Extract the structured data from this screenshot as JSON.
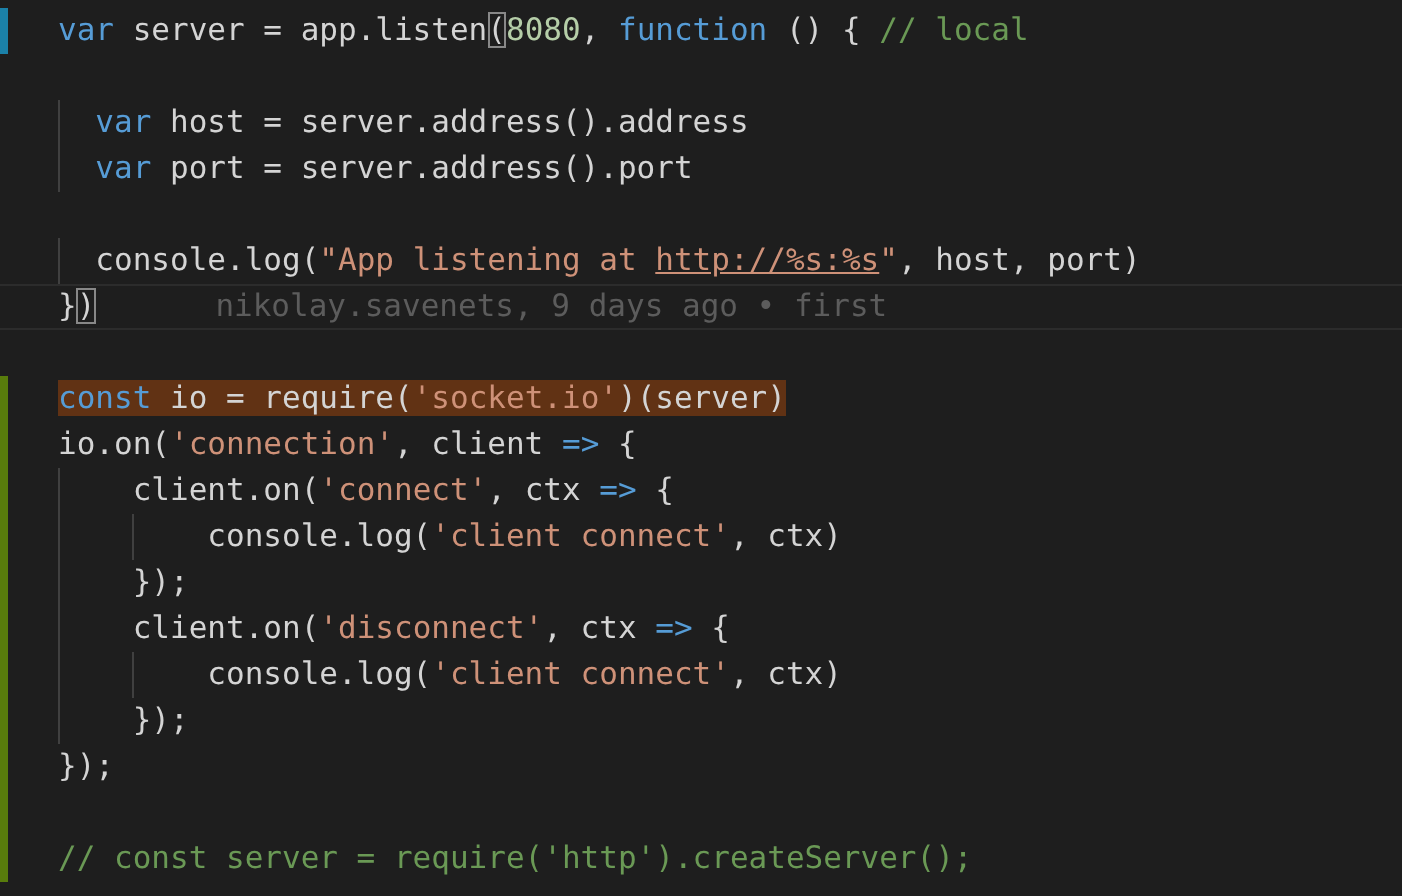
{
  "editor": {
    "lines": [
      {
        "kind": "code",
        "modified": true,
        "added": false,
        "tokens": [
          {
            "kind": "keyword",
            "text": "var"
          },
          {
            "kind": "plain",
            "text": " server = app.listen"
          },
          {
            "kind": "plain",
            "text": "(",
            "bracket_match": true
          },
          {
            "kind": "number",
            "text": "8080"
          },
          {
            "kind": "plain",
            "text": ", "
          },
          {
            "kind": "keyword",
            "text": "function"
          },
          {
            "kind": "plain",
            "text": " () { "
          },
          {
            "kind": "comment",
            "text": "// local"
          }
        ]
      },
      {
        "kind": "blank",
        "modified": false,
        "added": false
      },
      {
        "kind": "code",
        "modified": false,
        "added": false,
        "tokens": [
          {
            "kind": "keyword",
            "text": "  var"
          },
          {
            "kind": "plain",
            "text": " host = server.address().address"
          }
        ]
      },
      {
        "kind": "code",
        "modified": false,
        "added": false,
        "tokens": [
          {
            "kind": "keyword",
            "text": "  var"
          },
          {
            "kind": "plain",
            "text": " port = server.address().port"
          }
        ]
      },
      {
        "kind": "blank",
        "modified": false,
        "added": false
      },
      {
        "kind": "code",
        "modified": false,
        "added": false,
        "tokens": [
          {
            "kind": "plain",
            "text": "  console.log("
          },
          {
            "kind": "string",
            "text": "\"App listening at "
          },
          {
            "kind": "string",
            "text": "http://%s:%s",
            "link": true
          },
          {
            "kind": "string",
            "text": "\""
          },
          {
            "kind": "plain",
            "text": ", host, port)"
          }
        ]
      },
      {
        "kind": "code",
        "modified": false,
        "added": false,
        "current": true,
        "blame": "nikolay.savenets, 9 days ago • first",
        "tokens": [
          {
            "kind": "plain",
            "text": "}"
          },
          {
            "kind": "plain",
            "text": ")",
            "bracket_match": true
          }
        ]
      },
      {
        "kind": "blank",
        "modified": false,
        "added": false
      },
      {
        "kind": "code",
        "modified": false,
        "added": true,
        "highlighted": true,
        "tokens": [
          {
            "kind": "keyword",
            "text": "const"
          },
          {
            "kind": "plain",
            "text": " io = require("
          },
          {
            "kind": "string",
            "text": "'socket.io'"
          },
          {
            "kind": "plain",
            "text": ")(server)"
          }
        ]
      },
      {
        "kind": "code",
        "modified": false,
        "added": true,
        "tokens": [
          {
            "kind": "plain",
            "text": "io.on("
          },
          {
            "kind": "string",
            "text": "'connection'"
          },
          {
            "kind": "plain",
            "text": ", client "
          },
          {
            "kind": "keyword",
            "text": "=>"
          },
          {
            "kind": "plain",
            "text": " {"
          }
        ]
      },
      {
        "kind": "code",
        "modified": false,
        "added": true,
        "tokens": [
          {
            "kind": "plain",
            "text": "    client.on("
          },
          {
            "kind": "string",
            "text": "'connect'"
          },
          {
            "kind": "plain",
            "text": ", ctx "
          },
          {
            "kind": "keyword",
            "text": "=>"
          },
          {
            "kind": "plain",
            "text": " {"
          }
        ]
      },
      {
        "kind": "code",
        "modified": false,
        "added": true,
        "tokens": [
          {
            "kind": "plain",
            "text": "        console.log("
          },
          {
            "kind": "string",
            "text": "'client connect'"
          },
          {
            "kind": "plain",
            "text": ", ctx)"
          }
        ]
      },
      {
        "kind": "code",
        "modified": false,
        "added": true,
        "tokens": [
          {
            "kind": "plain",
            "text": "    });"
          }
        ]
      },
      {
        "kind": "code",
        "modified": false,
        "added": true,
        "tokens": [
          {
            "kind": "plain",
            "text": "    client.on("
          },
          {
            "kind": "string",
            "text": "'disconnect'"
          },
          {
            "kind": "plain",
            "text": ", ctx "
          },
          {
            "kind": "keyword",
            "text": "=>"
          },
          {
            "kind": "plain",
            "text": " {"
          }
        ]
      },
      {
        "kind": "code",
        "modified": false,
        "added": true,
        "tokens": [
          {
            "kind": "plain",
            "text": "        console.log("
          },
          {
            "kind": "string",
            "text": "'client connect'"
          },
          {
            "kind": "plain",
            "text": ", ctx)"
          }
        ]
      },
      {
        "kind": "code",
        "modified": false,
        "added": true,
        "tokens": [
          {
            "kind": "plain",
            "text": "    });"
          }
        ]
      },
      {
        "kind": "code",
        "modified": false,
        "added": true,
        "tokens": [
          {
            "kind": "plain",
            "text": "});"
          }
        ]
      },
      {
        "kind": "blank",
        "modified": false,
        "added": true
      },
      {
        "kind": "code",
        "modified": false,
        "added": true,
        "tokens": [
          {
            "kind": "comment",
            "text": "// const server = require('http').createServer();"
          }
        ]
      }
    ]
  }
}
